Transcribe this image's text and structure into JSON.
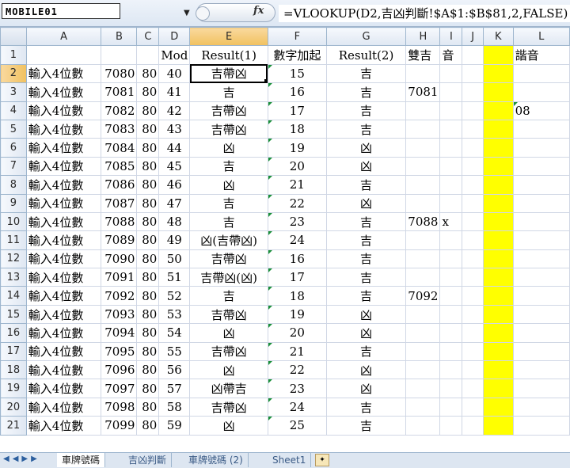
{
  "watermark": "MOBILE01",
  "formula_bar": {
    "fx_label": "fx",
    "formula": "=VLOOKUP(D2,吉凶判斷!$A$1:$B$81,2,FALSE)"
  },
  "columns": [
    "A",
    "B",
    "C",
    "D",
    "E",
    "F",
    "G",
    "H",
    "I",
    "J",
    "K",
    "L"
  ],
  "selected_column": "E",
  "header_row": {
    "row": "1",
    "a": "",
    "b": "",
    "c": "",
    "d": "Mod",
    "e": "Result(1)",
    "f": "數字加起",
    "g": "Result(2)",
    "h": "雙吉",
    "i": "音",
    "j": "",
    "k": "",
    "l": "諧音"
  },
  "rows": [
    {
      "row": "2",
      "a": "輸入4位數",
      "b": "7080",
      "c": "80",
      "d": "40",
      "e": "吉帶凶",
      "f": "15",
      "g": "吉",
      "h": "",
      "i": "",
      "l": ""
    },
    {
      "row": "3",
      "a": "輸入4位數",
      "b": "7081",
      "c": "80",
      "d": "41",
      "e": "吉",
      "f": "16",
      "g": "吉",
      "h": "7081",
      "i": "",
      "l": ""
    },
    {
      "row": "4",
      "a": "輸入4位數",
      "b": "7082",
      "c": "80",
      "d": "42",
      "e": "吉帶凶",
      "f": "17",
      "g": "吉",
      "h": "",
      "i": "",
      "l": "08"
    },
    {
      "row": "5",
      "a": "輸入4位數",
      "b": "7083",
      "c": "80",
      "d": "43",
      "e": "吉帶凶",
      "f": "18",
      "g": "吉",
      "h": "",
      "i": "",
      "l": ""
    },
    {
      "row": "6",
      "a": "輸入4位數",
      "b": "7084",
      "c": "80",
      "d": "44",
      "e": "凶",
      "f": "19",
      "g": "凶",
      "h": "",
      "i": "",
      "l": ""
    },
    {
      "row": "7",
      "a": "輸入4位數",
      "b": "7085",
      "c": "80",
      "d": "45",
      "e": "吉",
      "f": "20",
      "g": "凶",
      "h": "",
      "i": "",
      "l": ""
    },
    {
      "row": "8",
      "a": "輸入4位數",
      "b": "7086",
      "c": "80",
      "d": "46",
      "e": "凶",
      "f": "21",
      "g": "吉",
      "h": "",
      "i": "",
      "l": ""
    },
    {
      "row": "9",
      "a": "輸入4位數",
      "b": "7087",
      "c": "80",
      "d": "47",
      "e": "吉",
      "f": "22",
      "g": "凶",
      "h": "",
      "i": "",
      "l": ""
    },
    {
      "row": "10",
      "a": "輸入4位數",
      "b": "7088",
      "c": "80",
      "d": "48",
      "e": "吉",
      "f": "23",
      "g": "吉",
      "h": "7088",
      "i": "x",
      "l": ""
    },
    {
      "row": "11",
      "a": "輸入4位數",
      "b": "7089",
      "c": "80",
      "d": "49",
      "e": "凶(吉帶凶)",
      "f": "24",
      "g": "吉",
      "h": "",
      "i": "",
      "l": ""
    },
    {
      "row": "12",
      "a": "輸入4位數",
      "b": "7090",
      "c": "80",
      "d": "50",
      "e": "吉帶凶",
      "f": "16",
      "g": "吉",
      "h": "",
      "i": "",
      "l": ""
    },
    {
      "row": "13",
      "a": "輸入4位數",
      "b": "7091",
      "c": "80",
      "d": "51",
      "e": "吉帶凶(凶)",
      "f": "17",
      "g": "吉",
      "h": "",
      "i": "",
      "l": ""
    },
    {
      "row": "14",
      "a": "輸入4位數",
      "b": "7092",
      "c": "80",
      "d": "52",
      "e": "吉",
      "f": "18",
      "g": "吉",
      "h": "7092",
      "i": "",
      "l": ""
    },
    {
      "row": "15",
      "a": "輸入4位數",
      "b": "7093",
      "c": "80",
      "d": "53",
      "e": "吉帶凶",
      "f": "19",
      "g": "凶",
      "h": "",
      "i": "",
      "l": ""
    },
    {
      "row": "16",
      "a": "輸入4位數",
      "b": "7094",
      "c": "80",
      "d": "54",
      "e": "凶",
      "f": "20",
      "g": "凶",
      "h": "",
      "i": "",
      "l": ""
    },
    {
      "row": "17",
      "a": "輸入4位數",
      "b": "7095",
      "c": "80",
      "d": "55",
      "e": "吉帶凶",
      "f": "21",
      "g": "吉",
      "h": "",
      "i": "",
      "l": ""
    },
    {
      "row": "18",
      "a": "輸入4位數",
      "b": "7096",
      "c": "80",
      "d": "56",
      "e": "凶",
      "f": "22",
      "g": "凶",
      "h": "",
      "i": "",
      "l": ""
    },
    {
      "row": "19",
      "a": "輸入4位數",
      "b": "7097",
      "c": "80",
      "d": "57",
      "e": "凶帶吉",
      "f": "23",
      "g": "凶",
      "h": "",
      "i": "",
      "l": ""
    },
    {
      "row": "20",
      "a": "輸入4位數",
      "b": "7098",
      "c": "80",
      "d": "58",
      "e": "吉帶凶",
      "f": "24",
      "g": "吉",
      "h": "",
      "i": "",
      "l": ""
    },
    {
      "row": "21",
      "a": "輸入4位數",
      "b": "7099",
      "c": "80",
      "d": "59",
      "e": "凶",
      "f": "25",
      "g": "吉",
      "h": "",
      "i": "",
      "l": ""
    }
  ],
  "sheet_tabs": [
    "車牌號碼",
    "吉凶判斷",
    "車牌號碼 (2)",
    "Sheet1"
  ],
  "active_tab_index": 0,
  "highlight_color": "#ffff00",
  "selection_color": "#f1c15f"
}
